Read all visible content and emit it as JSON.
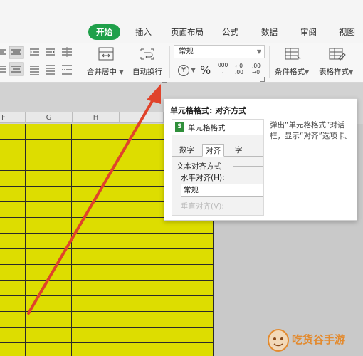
{
  "tabs": [
    {
      "label": "开始",
      "active": true
    },
    {
      "label": "插入"
    },
    {
      "label": "页面布局"
    },
    {
      "label": "公式"
    },
    {
      "label": "数据"
    },
    {
      "label": "审阅"
    },
    {
      "label": "视图"
    }
  ],
  "ribbon": {
    "merge_center": "合并居中",
    "wrap_text": "自动换行",
    "number_format": "常规",
    "cond_format": "条件格式",
    "table_style": "表格样式",
    "percent": "%",
    "thousands": "000",
    "inc_decimal": "←0\n.00",
    "dec_decimal": ".00\n→0",
    "currency": "¥"
  },
  "columns": [
    "F",
    "G",
    "H"
  ],
  "tooltip": {
    "title": "单元格格式: 对齐方式",
    "description": "弹出“单元格格式”对话框，显示“对齐”选项卡。",
    "dialog_title": "单元格格式",
    "dialog_tabs": [
      "数字",
      "对齐",
      "字"
    ],
    "section": "文本对齐方式",
    "h_align_label": "水平对齐(H):",
    "h_align_value": "常规",
    "v_align_label": "垂直对齐(V):"
  },
  "watermark": "吃货谷手游",
  "colors": {
    "accent": "#1fa04a",
    "cell_fill": "#dddd00",
    "arrow": "#e0432b"
  }
}
